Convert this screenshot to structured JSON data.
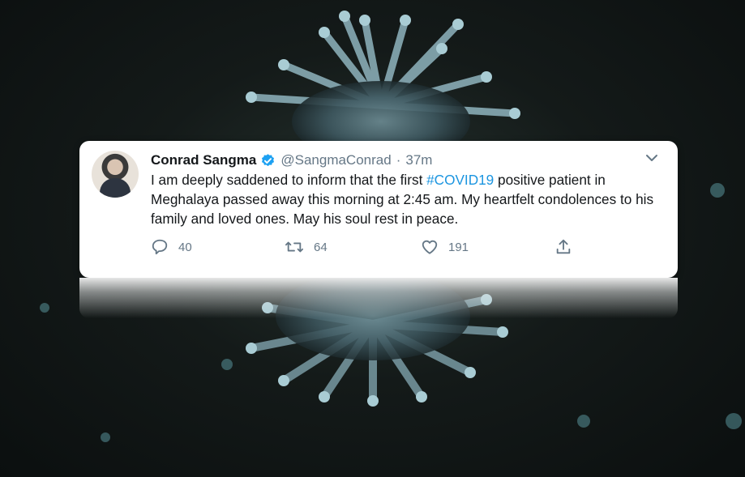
{
  "tweet": {
    "name": "Conrad Sangma",
    "handle": "@SangmaConrad",
    "separator": "·",
    "time": "37m",
    "text_before": "I am deeply saddened to inform that the first ",
    "hashtag": "#COVID19",
    "text_after": " positive patient in Meghalaya passed away this morning at 2:45 am. My heartfelt condolences to his family and loved ones. May his soul rest in peace.",
    "replies": "40",
    "retweets": "64",
    "likes": "191"
  },
  "colors": {
    "accent": "#1b95e0",
    "text": "#14171a",
    "muted": "#657786",
    "verified": "#1da1f2"
  },
  "icons": [
    "verified-badge-icon",
    "chevron-down-icon",
    "reply-icon",
    "retweet-icon",
    "like-icon",
    "share-icon"
  ]
}
